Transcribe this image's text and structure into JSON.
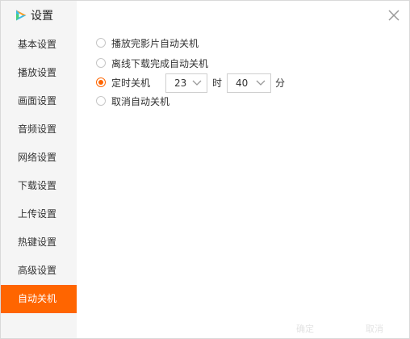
{
  "window": {
    "title": "设置"
  },
  "sidebar": {
    "items": [
      {
        "label": "基本设置",
        "active": false
      },
      {
        "label": "播放设置",
        "active": false
      },
      {
        "label": "画面设置",
        "active": false
      },
      {
        "label": "音频设置",
        "active": false
      },
      {
        "label": "网络设置",
        "active": false
      },
      {
        "label": "下载设置",
        "active": false
      },
      {
        "label": "上传设置",
        "active": false
      },
      {
        "label": "热键设置",
        "active": false
      },
      {
        "label": "高级设置",
        "active": false
      },
      {
        "label": "自动关机",
        "active": true
      }
    ]
  },
  "options": [
    {
      "label": "播放完影片自动关机",
      "checked": false
    },
    {
      "label": "离线下载完成自动关机",
      "checked": false
    },
    {
      "label": "定时关机",
      "checked": true
    },
    {
      "label": "取消自动关机",
      "checked": false
    }
  ],
  "timer": {
    "hour_value": "23",
    "hour_unit": "时",
    "minute_value": "40",
    "minute_unit": "分"
  },
  "watermark": {
    "left": "确定",
    "right": "取消"
  },
  "colors": {
    "accent": "#ff6500",
    "sidebar_bg": "#f5f5f5",
    "border": "#cfcfcf"
  },
  "icons": {
    "logo": "video-play-logo-icon",
    "close": "close-icon",
    "dropdown": "chevron-down-icon"
  }
}
